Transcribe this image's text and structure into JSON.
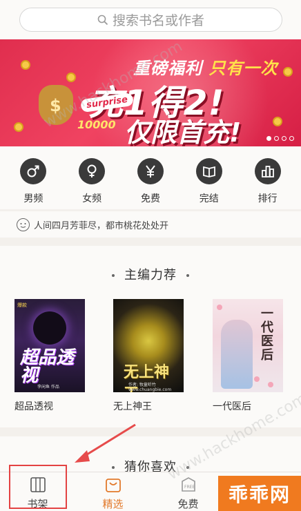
{
  "search": {
    "placeholder": "搜索书名或作者"
  },
  "banner": {
    "line1_a": "重磅福利",
    "line1_b": "只有一次",
    "line2": "充1得2!",
    "line3": "仅限首充!",
    "badge": "surprise",
    "amount": "10000"
  },
  "categories": [
    {
      "label": "男频",
      "icon": "male-icon"
    },
    {
      "label": "女频",
      "icon": "female-icon"
    },
    {
      "label": "免费",
      "icon": "yen-icon"
    },
    {
      "label": "完结",
      "icon": "book-open-icon"
    },
    {
      "label": "排行",
      "icon": "ranking-icon"
    }
  ],
  "notice": {
    "text": "人间四月芳菲尽，都市桃花处处开"
  },
  "recommend": {
    "title": "主编力荐",
    "books": [
      {
        "title": "超品透视",
        "cover_text": "超品透视",
        "cover_tag": "爆款",
        "cover_author": "李闲鱼  作品"
      },
      {
        "title": "无上神王",
        "cover_text": "无上神王",
        "cover_author": "作者: 牧童听竹  www.chuangbie.com"
      },
      {
        "title": "一代医后",
        "cover_text": "一代医后"
      }
    ]
  },
  "guess": {
    "title": "猜你喜欢"
  },
  "tabbar": {
    "items": [
      {
        "label": "书架",
        "icon": "bookshelf-icon"
      },
      {
        "label": "精选",
        "icon": "bag-icon"
      },
      {
        "label": "免费",
        "icon": "free-icon"
      },
      {
        "label": "",
        "icon": "account-icon"
      }
    ]
  },
  "watermark": {
    "site": "www.hackhome.com",
    "brand": "乖乖网"
  },
  "colors": {
    "accent": "#e2792b",
    "banner": "#e02e4e",
    "highlight_box": "#e34242"
  }
}
